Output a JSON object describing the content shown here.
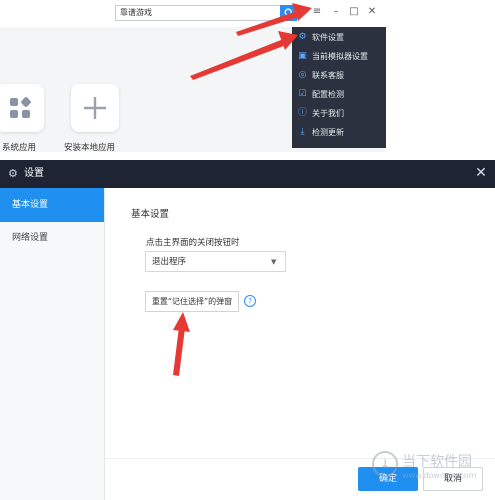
{
  "launcher": {
    "search": {
      "value": "靠谱游戏",
      "button_icon": "search-icon"
    },
    "window_controls": {
      "menu_icon": "≡",
      "minimize_icon": "–",
      "maximize_icon": "□",
      "close_icon": "✕"
    },
    "apps": [
      {
        "label": "系统应用",
        "icon": "grid-icon"
      },
      {
        "label": "安装本地应用",
        "icon": "plus-icon"
      }
    ],
    "dropdown": {
      "items": [
        {
          "label": "软件设置",
          "icon": "gear-icon"
        },
        {
          "label": "当前模拟器设置",
          "icon": "monitor-icon"
        },
        {
          "label": "联系客服",
          "icon": "headset-icon"
        },
        {
          "label": "配置检测",
          "icon": "check-icon"
        },
        {
          "label": "关于我们",
          "icon": "info-icon"
        },
        {
          "label": "检测更新",
          "icon": "download-icon"
        }
      ]
    }
  },
  "dialog": {
    "title": "设置",
    "close_icon": "✕",
    "nav": [
      {
        "label": "基本设置",
        "active": true
      },
      {
        "label": "网络设置",
        "active": false
      }
    ],
    "section_title": "基本设置",
    "close_behavior_prompt": "点击主界面的关闭按钮时",
    "close_behavior_value": "退出程序",
    "reset_button": "重置“记住选择”的弹窗",
    "help_icon": "?",
    "ok_button": "确定",
    "cancel_button": "取消"
  },
  "watermark": {
    "text": "当下软件园",
    "url": "www.downxia.com"
  },
  "colors": {
    "accent": "#1f8ff0",
    "dark_menu": "#2b313f",
    "titlebar": "#1e2434",
    "arrow": "#e53935"
  }
}
